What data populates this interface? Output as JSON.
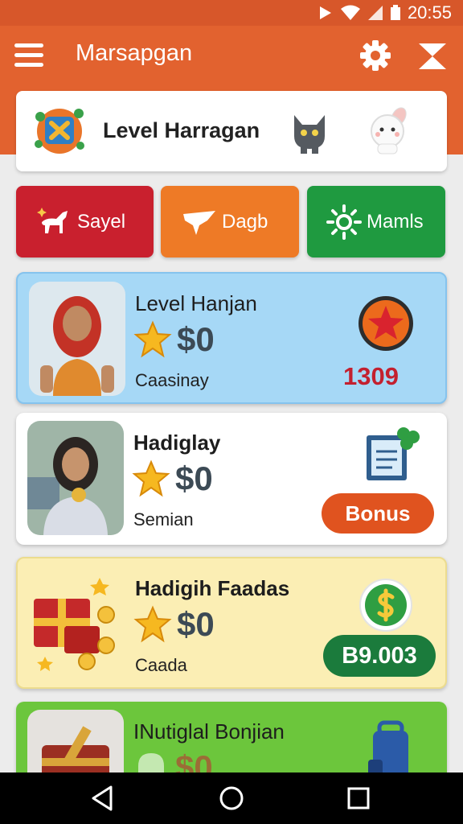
{
  "status_bar": {
    "time": "20:55"
  },
  "app_bar": {
    "title": "Marsapgan",
    "menu_icon": "hamburger-menu-icon",
    "settings_icon": "gear-icon",
    "mail_icon": "envelope-icon"
  },
  "header": {
    "title": "Level Harragan"
  },
  "tabs": [
    {
      "label": "Sayel",
      "color": "#c9202e",
      "icon": "goat-icon"
    },
    {
      "label": "Dagb",
      "color": "#ee7a26",
      "icon": "ribbon-icon"
    },
    {
      "label": "Mamls",
      "color": "#1f9a40",
      "icon": "sun-spiral-icon"
    }
  ],
  "cards": [
    {
      "title": "Level Hanjan",
      "amount": "$0",
      "subtitle": "Caasinay",
      "points": "1309",
      "color": "#a6d8f6"
    },
    {
      "title": "Hadiglay",
      "amount": "$0",
      "subtitle": "Semian",
      "button": "Bonus",
      "color": "#ffffff"
    },
    {
      "title": "Hadigih Faadas",
      "amount": "$0",
      "subtitle": "Caada",
      "pill": "B9.003",
      "color": "#fbeeb4"
    },
    {
      "title": "INutiglal Bonjian",
      "amount": "$0",
      "color": "#6cc63c"
    }
  ]
}
